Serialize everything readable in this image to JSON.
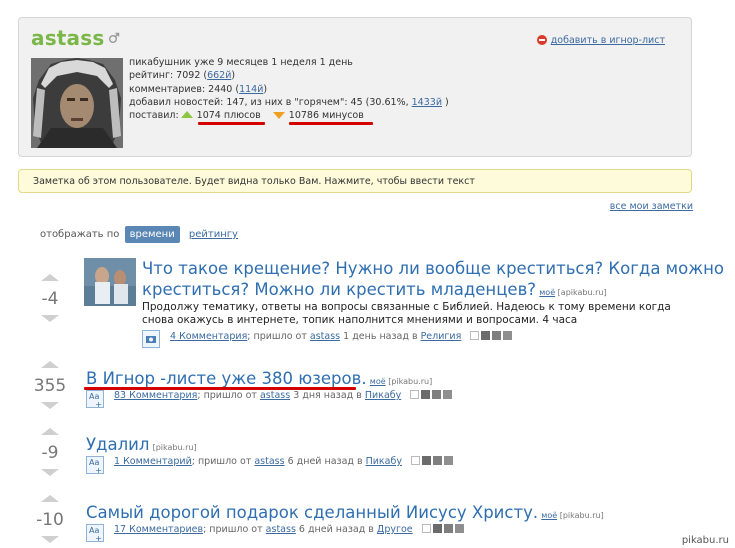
{
  "profile": {
    "username": "astass",
    "ignore_label": "добавить в игнор-лист",
    "member_for": "пикабушник уже 9 месяцев 1 неделя 1 день",
    "rating_prefix": "рейтинг: 7092 (",
    "rating_link": "662й",
    "rating_suffix": ")",
    "comments_prefix": "комментариев: 2440 (",
    "comments_link": "114й",
    "comments_suffix": ")",
    "news_prefix": "добавил новостей: 147, из них в \"горячем\": 45 (30.61%, ",
    "news_link": "1433й",
    "news_suffix": " )",
    "voted_label": "поставил:",
    "pluses": "1074 плюсов",
    "minuses": "10786 минусов"
  },
  "note": {
    "text": "Заметка об этом пользователе. Будет видна только Вам. Нажмите, чтобы ввести текст",
    "all_notes": "все мои заметки"
  },
  "sort": {
    "label": "отображать по",
    "active": "времени",
    "other": "рейтингу"
  },
  "posts": [
    {
      "score": "-4",
      "title_line1": "Что такое крещение? Нужно ли вообще креститься? Когда можно",
      "title_line2": "креститься? Можно ли крестить младенцев?",
      "more": "моё",
      "source": "[apikabu.ru]",
      "desc_line1": "Продолжу тематику, ответы на вопросы связанные с Библией. Надеюсь к тому времени когда",
      "desc_line2": "снова окажусь в интернете, топик наполнится мнениями и вопросами. 4 часа",
      "comments": "4 Комментария",
      "meta_mid": "; пришло от ",
      "author": "astass",
      "time": " 1 день назад в ",
      "category": "Религия"
    },
    {
      "score": "355",
      "title": "В Игнор -листе уже 380 юзеров.",
      "more": "моё",
      "source": "[pikabu.ru]",
      "comments": "83 Комментария",
      "meta_mid": "; пришло от ",
      "author": "astass",
      "time": " 3 дня назад в ",
      "category": "Пикабу"
    },
    {
      "score": "-9",
      "title": "Удалил",
      "source": "[pikabu.ru]",
      "comments": "1 Комментарий",
      "meta_mid": "; пришло от ",
      "author": "astass",
      "time": " 6 дней назад в ",
      "category": "Пикабу"
    },
    {
      "score": "-10",
      "title": "Самый дорогой подарок сделанный Иисусу Христу.",
      "more": "моё",
      "source": "[pikabu.ru]",
      "comments": "17 Комментариев",
      "meta_mid": "; пришло от ",
      "author": "astass",
      "time": " 6 дней назад в ",
      "category": "Другое"
    }
  ],
  "watermark": "pikabu.ru",
  "colors": {
    "username": "#7ab648",
    "link": "#3b6aa0",
    "title": "#2f6fb1",
    "highlight_underline": "#d40000",
    "sort_active_bg": "#5b87b5",
    "note_bg": "#fdfbd9"
  }
}
